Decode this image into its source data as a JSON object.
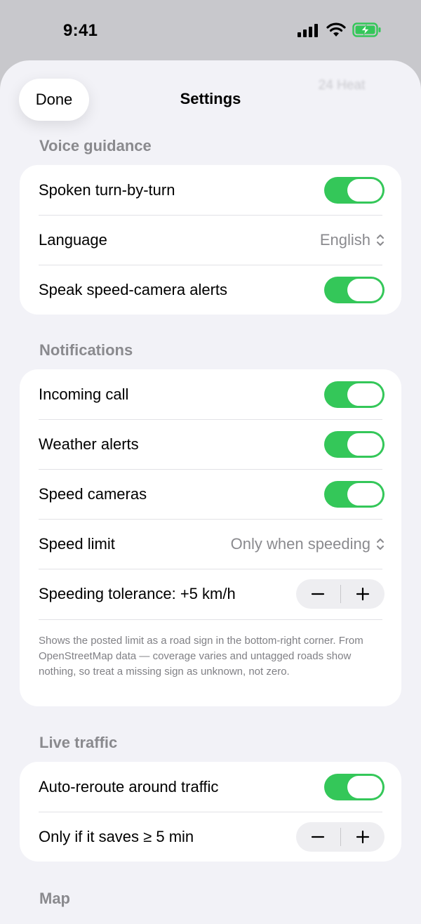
{
  "status": {
    "time": "9:41"
  },
  "nav": {
    "done_label": "Done",
    "title": "Settings",
    "ghost_label": "24 Heat"
  },
  "voice": {
    "header": "Voice guidance",
    "spoken_label": "Spoken turn-by-turn",
    "language_label": "Language",
    "language_value": "English",
    "speed_camera_label": "Speak speed-camera alerts"
  },
  "notifications": {
    "header": "Notifications",
    "incoming_call_label": "Incoming call",
    "weather_label": "Weather alerts",
    "speed_cameras_label": "Speed cameras",
    "speed_limit_label": "Speed limit",
    "speed_limit_value": "Only when speeding",
    "tolerance_label": "Speeding tolerance: +5 km/h",
    "footnote": "Shows the posted limit as a road sign in the bottom-right corner. From OpenStreetMap data — coverage varies and untagged roads show nothing, so treat a missing sign as unknown, not zero."
  },
  "traffic": {
    "header": "Live traffic",
    "auto_reroute_label": "Auto-reroute around traffic",
    "saves_label": "Only if it saves ≥ 5 min"
  },
  "map": {
    "header": "Map"
  },
  "colors": {
    "toggle_on": "#34c759",
    "background": "#f2f2f7",
    "secondary_text": "#8a8a8e"
  },
  "icons": [
    "cellular-signal-icon",
    "wifi-icon",
    "battery-charging-icon",
    "chevron-updown-icon",
    "minus-icon",
    "plus-icon"
  ]
}
